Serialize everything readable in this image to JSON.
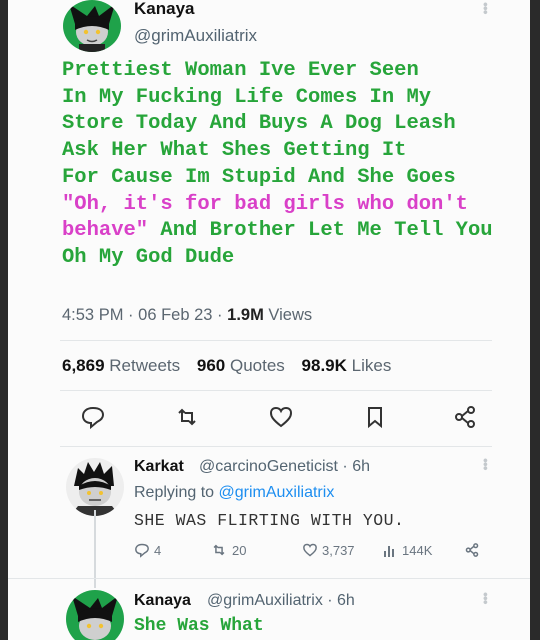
{
  "tweet": {
    "author_name": "Kanaya",
    "author_handle": "@grimAuxiliatrix",
    "body_lines_green_1": [
      "Prettiest Woman Ive Ever Seen",
      "In My Fucking Life Comes In My",
      "Store Today And Buys A Dog Leash",
      "Ask Her What Shes Getting It",
      "For Cause Im Stupid And She Goes"
    ],
    "body_pink": "\"Oh, it's for bad girls who don't behave\"",
    "body_green_after_pink": " And Brother Let Me Tell You",
    "body_last_line": "Oh My God Dude",
    "time": "4:53 PM",
    "date": "06 Feb 23",
    "views_count": "1.9M",
    "views_label": "Views",
    "retweets_count": "6,869",
    "retweets_label": "Retweets",
    "quotes_count": "960",
    "quotes_label": "Quotes",
    "likes_count": "98.9K",
    "likes_label": "Likes",
    "colors": {
      "green_text": "#27a53a",
      "pink_text": "#d940c8",
      "link": "#1d8ef0"
    }
  },
  "reply1": {
    "author_name": "Karkat",
    "author_handle": "@carcinoGeneticist",
    "age": "6h",
    "replying_prefix": "Replying to",
    "replying_to": "@grimAuxiliatrix",
    "text": "SHE WAS FLIRTING WITH YOU.",
    "replies": "4",
    "retweets": "20",
    "likes": "3,737",
    "views": "144K"
  },
  "reply2": {
    "author_name": "Kanaya",
    "author_handle": "@grimAuxiliatrix",
    "age": "6h",
    "text": "She Was What"
  }
}
